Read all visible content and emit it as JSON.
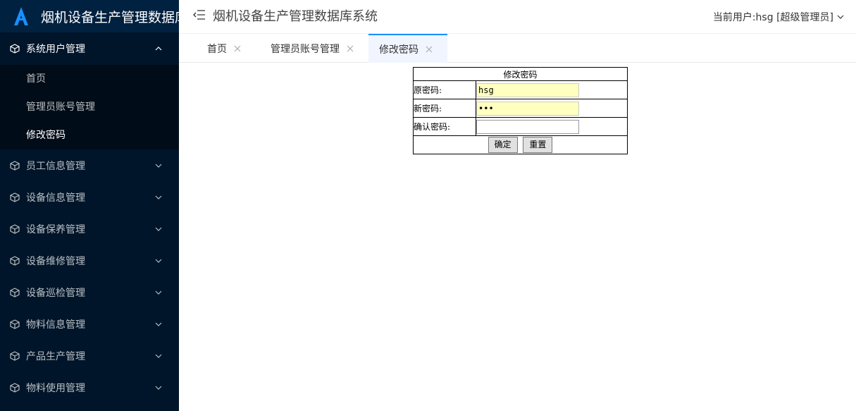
{
  "app": {
    "logo_title": "烟机设备生产管理数据库",
    "top_title": "烟机设备生产管理数据库系统",
    "current_user": "当前用户:hsg [超级管理员]",
    "accent_color": "#1890ff",
    "sidebar_bg": "#001529"
  },
  "sidebar": {
    "open_group": {
      "label": "系统用户管理",
      "icon": "cube-icon"
    },
    "submenu": [
      {
        "label": "首页",
        "active": false
      },
      {
        "label": "管理员账号管理",
        "active": false
      },
      {
        "label": "修改密码",
        "active": true
      }
    ],
    "groups": [
      {
        "label": "员工信息管理",
        "icon": "cube-icon"
      },
      {
        "label": "设备信息管理",
        "icon": "cube-icon"
      },
      {
        "label": "设备保养管理",
        "icon": "cube-icon"
      },
      {
        "label": "设备维修管理",
        "icon": "cube-icon"
      },
      {
        "label": "设备巡检管理",
        "icon": "cube-icon"
      },
      {
        "label": "物料信息管理",
        "icon": "cube-icon"
      },
      {
        "label": "产品生产管理",
        "icon": "cube-icon"
      },
      {
        "label": "物料使用管理",
        "icon": "cube-icon"
      }
    ]
  },
  "tabs": [
    {
      "label": "首页",
      "active": false
    },
    {
      "label": "管理员账号管理",
      "active": false
    },
    {
      "label": "修改密码",
      "active": true
    }
  ],
  "form": {
    "caption": "修改密码",
    "old_label": "原密码:",
    "old_value": "hsg",
    "new_label": "新密码:",
    "new_value": "•••",
    "confirm_label": "确认密码:",
    "confirm_value": "",
    "submit_label": "确定",
    "reset_label": "重置"
  }
}
